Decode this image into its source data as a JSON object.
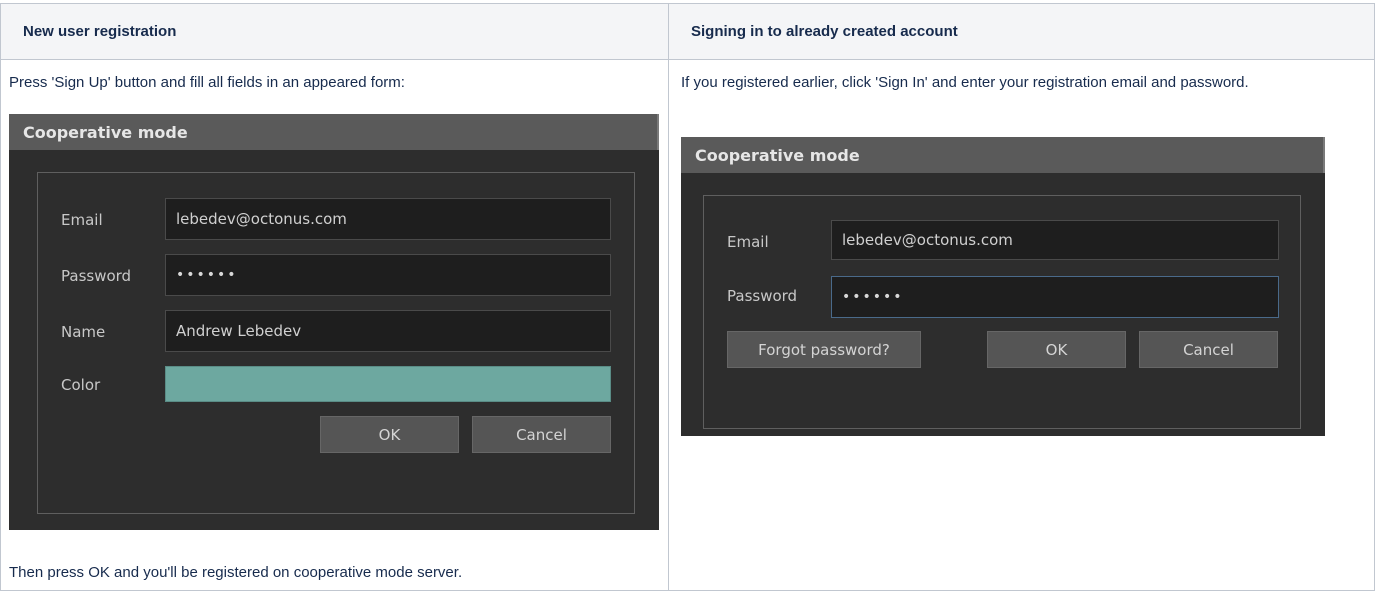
{
  "table": {
    "headers": [
      "New user registration",
      "Signing in to already created account"
    ],
    "left": {
      "intro": "Press 'Sign Up' button and fill all fields in an appeared form:",
      "outro": "Then press OK and you'll be registered on cooperative mode server."
    },
    "right": {
      "intro": "If you registered earlier, click 'Sign In' and enter your registration email and password."
    }
  },
  "signup_dialog": {
    "title": "Cooperative mode",
    "email_label": "Email",
    "email_value": "lebedev@octonus.com",
    "password_label": "Password",
    "password_value": "••••••",
    "name_label": "Name",
    "name_value": "Andrew Lebedev",
    "color_label": "Color",
    "color_value": "#6da8a0",
    "ok_label": "OK",
    "cancel_label": "Cancel"
  },
  "signin_dialog": {
    "title": "Cooperative mode",
    "email_label": "Email",
    "email_value": "lebedev@octonus.com",
    "password_label": "Password",
    "password_value": "••••••",
    "forgot_label": "Forgot password?",
    "ok_label": "OK",
    "cancel_label": "Cancel"
  }
}
